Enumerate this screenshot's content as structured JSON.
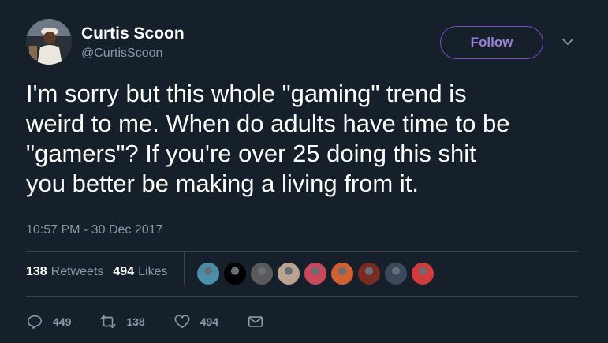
{
  "author": {
    "display_name": "Curtis Scoon",
    "handle": "@CurtisScoon"
  },
  "header": {
    "follow_label": "Follow",
    "menu_icon": "chevron-down-icon"
  },
  "tweet": {
    "text": "I'm sorry but this whole \"gaming\" trend is\nweird to me. When do adults have time to be\n\"gamers\"? If you're over 25 doing this shit\nyou better be making a living from it.",
    "timestamp": "10:57 PM - 30 Dec 2017"
  },
  "stats": {
    "retweets_count": "138",
    "retweets_label": "Retweets",
    "likes_count": "494",
    "likes_label": "Likes"
  },
  "likers": [
    {
      "name": "liker-1",
      "color": "#4a8fa8"
    },
    {
      "name": "liker-2",
      "color": "#000000"
    },
    {
      "name": "liker-3",
      "color": "#5a5a5a"
    },
    {
      "name": "liker-4",
      "color": "#b9a48f"
    },
    {
      "name": "liker-5",
      "color": "#c9485b"
    },
    {
      "name": "liker-6",
      "color": "#d2602e"
    },
    {
      "name": "liker-7",
      "color": "#7a2b1f"
    },
    {
      "name": "liker-8",
      "color": "#3a4a5a"
    },
    {
      "name": "liker-9",
      "color": "#d43a3a"
    }
  ],
  "actions": {
    "replies": "449",
    "retweets": "138",
    "likes": "494"
  },
  "colors": {
    "background": "#15202b",
    "accent": "#794bc4",
    "secondary_text": "#8899a6",
    "divider": "#38444d"
  }
}
